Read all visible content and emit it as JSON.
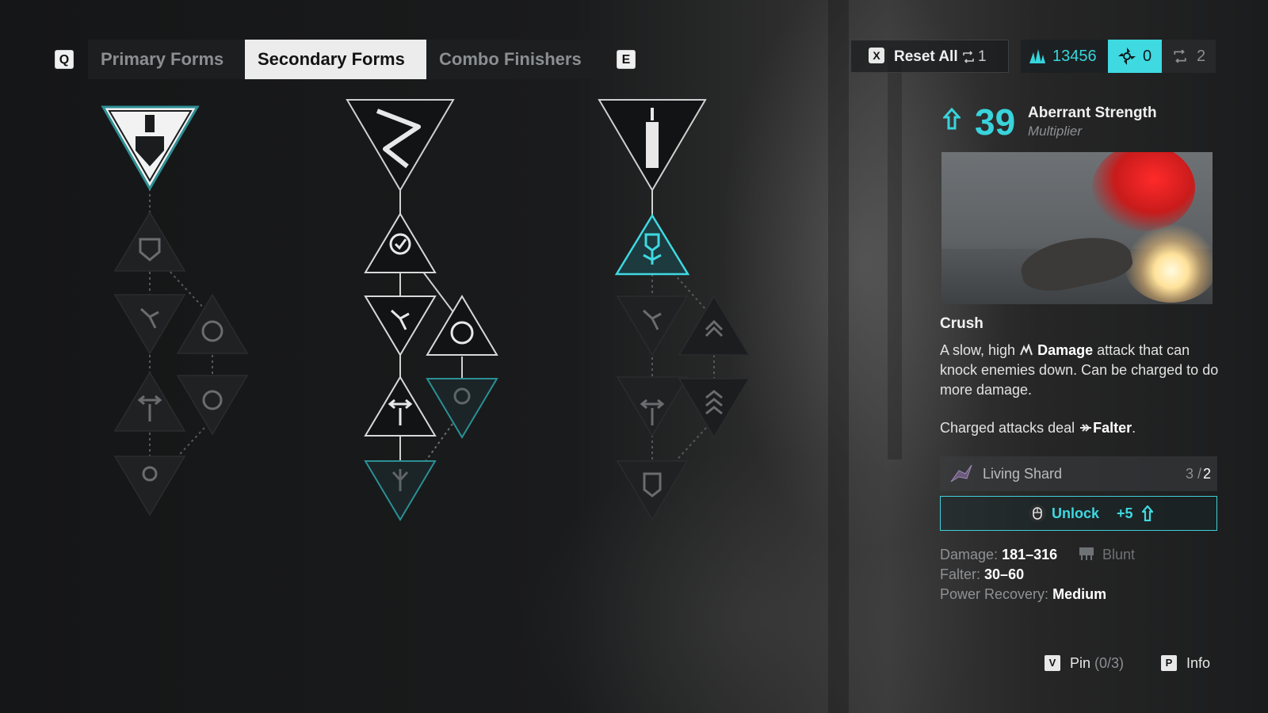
{
  "tabs": {
    "prev_key": "Q",
    "next_key": "E",
    "items": [
      {
        "label": "Primary Forms"
      },
      {
        "label": "Secondary Forms",
        "active": true
      },
      {
        "label": "Combo Finishers"
      }
    ]
  },
  "header": {
    "reset_key": "X",
    "reset_label": "Reset All",
    "reset_count": "1",
    "points": "13456",
    "shard_count": "0",
    "respec_count": "2"
  },
  "detail": {
    "level": "39",
    "stat_name": "Aberrant Strength",
    "stat_sub": "Multiplier",
    "title": "Crush",
    "desc_a": "A slow, high ",
    "desc_damage": "Damage",
    "desc_b": " attack that can knock enemies down. Can be charged to do more damage.",
    "charged_a": "Charged attacks deal ",
    "charged_falter": "Falter",
    "charged_end": ".",
    "requirement_name": "Living Shard",
    "requirement_have": "3",
    "requirement_sep": "/",
    "requirement_need": "2",
    "unlock_label": "Unlock",
    "unlock_amount": "+5",
    "damage_label": "Damage:",
    "damage_value": "181–316",
    "damage_type": "Blunt",
    "falter_label": "Falter:",
    "falter_value": "30–60",
    "power_label": "Power Recovery:",
    "power_value": "Medium"
  },
  "footer": {
    "pin_key": "V",
    "pin_label": "Pin",
    "pin_count": "(0/3)",
    "info_key": "P",
    "info_label": "Info"
  },
  "colors": {
    "accent": "#3fd9e1",
    "panel": "#1c1e20"
  },
  "trees": [
    {
      "name": "shovel-tree",
      "icons": [
        "shovel-icon",
        "shield-icon",
        "branch-icon",
        "lightning-icon",
        "split-arrows-icon",
        "alert-icon",
        "person-drop-icon"
      ]
    },
    {
      "name": "wrench-tree",
      "icons": [
        "wrench-icon",
        "check-drop-icon",
        "branch-icon",
        "ring-icon",
        "split-arrows-icon",
        "skull-icon",
        "plant-check-icon"
      ]
    },
    {
      "name": "spire-tree",
      "icons": [
        "spire-icon",
        "hand-crush-icon",
        "branch-icon",
        "drop-stack-icon",
        "split-arrows-icon",
        "flame-chevrons-icon",
        "chevron-stack-icon"
      ]
    }
  ]
}
